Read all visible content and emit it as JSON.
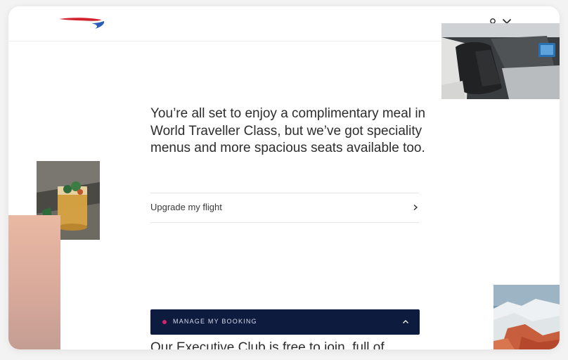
{
  "brand": {
    "logo_icon": "speedmarque-logo-icon",
    "colors": {
      "red": "#d2222d",
      "blue": "#2a5cb8",
      "navy": "#0d1b3e",
      "accent_dot": "#d4226b"
    }
  },
  "header": {
    "account_icon": "user-icon",
    "close_icon": "close-icon"
  },
  "main": {
    "headline": "You’re all set to enjoy a complimentary meal in World Traveller Class, but we’ve got speciality menus and more spacious seats available too.",
    "upgrade_link": {
      "label": "Upgrade my flight",
      "icon": "chevron-right-icon"
    }
  },
  "manage_bar": {
    "label": "MANAGE MY BOOKING",
    "icon": "chevron-up-icon"
  },
  "footer_text": "Our Executive Club is free to join, full of"
}
